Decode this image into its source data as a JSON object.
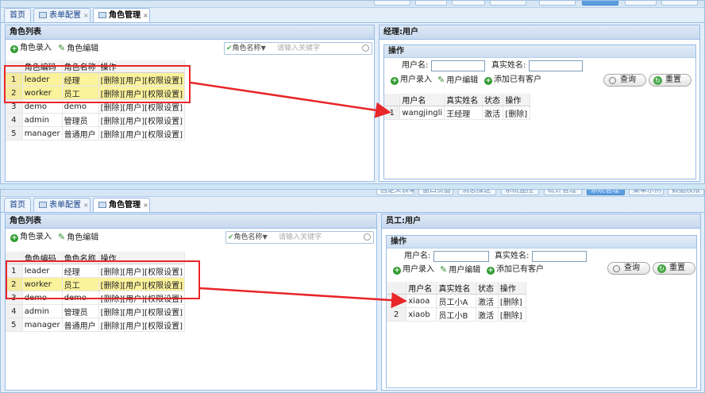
{
  "top": [
    {
      "top_buttons": [
        "",
        "",
        "",
        "",
        "",
        "",
        "",
        ""
      ]
    },
    {
      "top_buttons": [
        "自定义表单",
        "窗口页面",
        "消息推送",
        "系统监控",
        "统计管理",
        "系统管理",
        "菜单示例",
        "数据权限"
      ]
    }
  ],
  "tabs": {
    "home": "首页",
    "form_config": "表单配置",
    "role_mgmt": "角色管理",
    "close": "×"
  },
  "role_panel": {
    "title": "角色列表",
    "add_label": "角色录入",
    "edit_label": "角色编辑",
    "search_field": "角色名称",
    "search_placeholder": "请输入关键字",
    "headers": [
      "角色编码",
      "角色名称",
      "操作"
    ],
    "rows": [
      {
        "n": "1",
        "code": "leader",
        "name": "经理",
        "ops": "[删除][用户][权限设置]"
      },
      {
        "n": "2",
        "code": "worker",
        "name": "员工",
        "ops": "[删除][用户][权限设置]"
      },
      {
        "n": "3",
        "code": "demo",
        "name": "demo",
        "ops": "[删除][用户][权限设置]"
      },
      {
        "n": "4",
        "code": "admin",
        "name": "管理员",
        "ops": "[删除][用户][权限设置]"
      },
      {
        "n": "5",
        "code": "manager",
        "name": "普通用户",
        "ops": "[删除][用户][权限设置]"
      }
    ]
  },
  "user_panels": [
    {
      "title": "经理:用户",
      "ops_title": "操作",
      "username_label": "用户名:",
      "realname_label": "真实姓名:",
      "add_label": "用户录入",
      "edit_label": "用户编辑",
      "add_existing_label": "添加已有客户",
      "query_label": "查询",
      "reset_label": "重置",
      "headers": [
        "用户名",
        "真实姓名",
        "状态",
        "操作"
      ],
      "rows": [
        {
          "n": "1",
          "username": "wangjingli",
          "realname": "王经理",
          "status": "激活",
          "op": "[删除]"
        }
      ]
    },
    {
      "title": "员工:用户",
      "ops_title": "操作",
      "username_label": "用户名:",
      "realname_label": "真实姓名:",
      "add_label": "用户录入",
      "edit_label": "用户编辑",
      "add_existing_label": "添加已有客户",
      "query_label": "查询",
      "reset_label": "重置",
      "headers": [
        "用户名",
        "真实姓名",
        "状态",
        "操作"
      ],
      "rows": [
        {
          "n": "1",
          "username": "xiaoa",
          "realname": "员工小A",
          "status": "激活",
          "op": "[删除]"
        },
        {
          "n": "2",
          "username": "xiaob",
          "realname": "员工小B",
          "status": "激活",
          "op": "[删除]"
        }
      ]
    }
  ],
  "colors": {
    "highlight_row": "#fbf29c",
    "annotation_red": "#e8262a",
    "header_blue": "#99bbe8"
  }
}
